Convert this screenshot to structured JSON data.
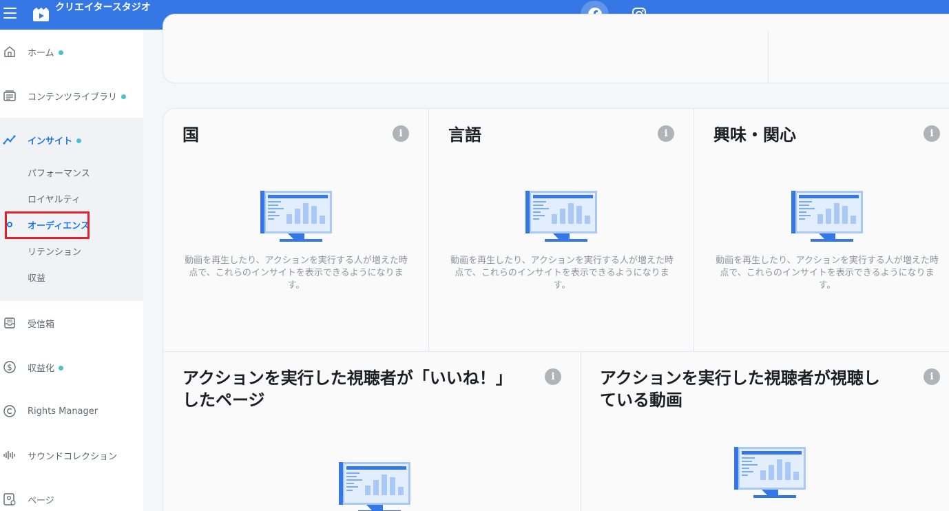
{
  "header": {
    "app_title": "クリエイタースタジオ",
    "platforms": [
      "facebook-icon",
      "instagram-icon"
    ]
  },
  "sidebar": {
    "items": [
      {
        "label": "ホーム",
        "icon": "home-icon",
        "dot": true
      },
      {
        "label": "コンテンツライブラリ",
        "icon": "content-library-icon",
        "dot": true
      },
      {
        "label": "インサイト",
        "icon": "insights-icon",
        "dot": true,
        "active": true
      },
      {
        "label": "受信箱",
        "icon": "inbox-icon",
        "dot": false
      },
      {
        "label": "収益化",
        "icon": "dollar-icon",
        "dot": true
      },
      {
        "label": "Rights Manager",
        "icon": "copyright-icon",
        "dot": false
      },
      {
        "label": "サウンドコレクション",
        "icon": "sound-wave-icon",
        "dot": false
      },
      {
        "label": "ページ",
        "icon": "page-settings-icon",
        "dot": false
      }
    ],
    "insight_sub_items": [
      {
        "label": "パフォーマンス"
      },
      {
        "label": "ロイヤルティ"
      },
      {
        "label": "オーディエンス",
        "active": true
      },
      {
        "label": "リテンション"
      },
      {
        "label": "収益"
      }
    ]
  },
  "panels": [
    {
      "title": "国",
      "empty_text": "動画を再生したり、アクションを実行する人が増えた時点で、これらのインサイトを表示できるようになります。"
    },
    {
      "title": "言語",
      "empty_text": "動画を再生したり、アクションを実行する人が増えた時点で、これらのインサイトを表示できるようになります。"
    },
    {
      "title": "興味・関心",
      "empty_text": "動画を再生したり、アクションを実行する人が増えた時点で、これらのインサイトを表示できるようになります。"
    },
    {
      "title": "アクションを実行した視聴者が「いいね！」したページ"
    },
    {
      "title": "アクションを実行した視聴者が視聴している動画"
    }
  ],
  "info_glyph": "i",
  "colors": {
    "header_blue": "#3578e5",
    "active_blue": "#1877f2",
    "dot_teal": "#4fc1c8",
    "highlight_red": "#e0202a"
  }
}
